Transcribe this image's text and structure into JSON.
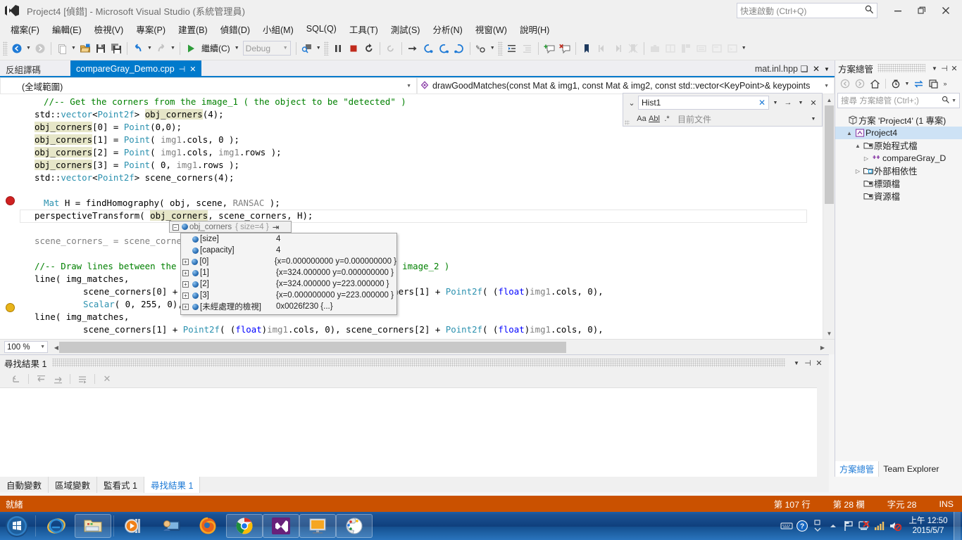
{
  "window": {
    "title": "Project4 [偵錯] - Microsoft Visual Studio (系統管理員)",
    "quick_launch_placeholder": "快速啟動 (Ctrl+Q)",
    "minimize": "—",
    "restore": "❐",
    "close": "✕"
  },
  "menu": {
    "items": [
      {
        "label": "檔案(F)"
      },
      {
        "label": "編輯(E)"
      },
      {
        "label": "檢視(V)"
      },
      {
        "label": "專案(P)"
      },
      {
        "label": "建置(B)"
      },
      {
        "label": "偵錯(D)"
      },
      {
        "label": "小組(M)"
      },
      {
        "label": "SQL(Q)"
      },
      {
        "label": "工具(T)"
      },
      {
        "label": "測試(S)"
      },
      {
        "label": "分析(N)"
      },
      {
        "label": "視窗(W)"
      },
      {
        "label": "說明(H)"
      }
    ]
  },
  "toolbar": {
    "continue_label": "繼續(C)",
    "config_value": "Debug"
  },
  "tabs": {
    "disasm_label": "反組譯碼",
    "active_label": "compareGray_Demo.cpp",
    "right_label": "mat.inl.hpp"
  },
  "navbar": {
    "scope": "(全域範圍)",
    "member": "drawGoodMatches(const Mat & img1, const Mat & img2, const std::vector<KeyPoint>& keypoints"
  },
  "editor": {
    "zoom": "100 %",
    "lines": [
      "//-- Get the corners from the image_1 ( the object to be \"detected\" )",
      "std::vector<Point2f> obj_corners(4);",
      "obj_corners[0] = Point(0,0);",
      "obj_corners[1] = Point( img1.cols, 0 );",
      "obj_corners[2] = Point( img1.cols, img1.rows );",
      "obj_corners[3] = Point( 0, img1.rows );",
      "std::vector<Point2f> scene_corners(4);",
      "",
      "Mat H = findHomography( obj, scene, RANSAC );",
      "perspectiveTransform( obj_corners, scene_corners, H);",
      "",
      "scene_corners_ = scene_corners;",
      "",
      "//-- Draw lines between the corners (the mapped object in the scene - image_2 )",
      "line( img_matches,",
      "      scene_corners[0] + Point2f( (float)img1.cols, 0), scene_corners[1] + Point2f( (float)img1.cols, 0),",
      "      Scalar( 0, 255, 0), 2, CV_AA );",
      "line( img_matches,",
      "      scene_corners[1] + Point2f( (float)img1.cols, 0), scene_corners[2] + Point2f( (float)img1.cols, 0),"
    ]
  },
  "find_popup": {
    "query": "Hist1",
    "scope": "目前文件",
    "match_case_icon": "Aa",
    "match_word_icon": "Abl",
    "regex_icon": ".*"
  },
  "datatip": {
    "header_name": "obj_corners",
    "header_meta": "{ size=4 }",
    "rows": [
      {
        "expander": "",
        "name": "[size]",
        "value": "4"
      },
      {
        "expander": "",
        "name": "[capacity]",
        "value": "4"
      },
      {
        "expander": "+",
        "name": "[0]",
        "value": "{x=0.000000000 y=0.000000000 }"
      },
      {
        "expander": "+",
        "name": "[1]",
        "value": "{x=324.000000 y=0.000000000 }"
      },
      {
        "expander": "+",
        "name": "[2]",
        "value": "{x=324.000000 y=223.000000 }"
      },
      {
        "expander": "+",
        "name": "[3]",
        "value": "{x=0.000000000 y=223.000000 }"
      },
      {
        "expander": "+",
        "name": "[未經處理的檢視]",
        "value": "0x0026f230 {...}"
      }
    ]
  },
  "find_results": {
    "title": "尋找結果 1"
  },
  "bottom_tabs": [
    {
      "label": "自動變數",
      "active": false
    },
    {
      "label": "區域變數",
      "active": false
    },
    {
      "label": "監看式 1",
      "active": false
    },
    {
      "label": "尋找結果 1",
      "active": true
    }
  ],
  "solution_explorer": {
    "title": "方案總管",
    "search_placeholder": "搜尋 方案總管 (Ctrl+;)",
    "tree": [
      {
        "label": "方案 'Project4' (1 專案)",
        "indent": 0,
        "twisty": "",
        "icon": "solution-icon",
        "selected": false
      },
      {
        "label": "Project4",
        "indent": 1,
        "twisty": "▲",
        "icon": "project-icon",
        "selected": true
      },
      {
        "label": "原始程式檔",
        "indent": 2,
        "twisty": "▲",
        "icon": "folder-icon",
        "selected": false
      },
      {
        "label": "compareGray_D",
        "indent": 3,
        "twisty": "▷",
        "icon": "cpp-file-icon",
        "selected": false
      },
      {
        "label": "外部相依性",
        "indent": 2,
        "twisty": "▷",
        "icon": "refs-icon",
        "selected": false
      },
      {
        "label": "標頭檔",
        "indent": 2,
        "twisty": "",
        "icon": "folder-icon",
        "selected": false
      },
      {
        "label": "資源檔",
        "indent": 2,
        "twisty": "",
        "icon": "folder-icon",
        "selected": false
      }
    ],
    "bottom_tabs": [
      {
        "label": "方案總管",
        "active": true
      },
      {
        "label": "Team Explorer",
        "active": false
      }
    ]
  },
  "status_bar": {
    "state": "就緒",
    "line": "第 107 行",
    "column": "第 28 欄",
    "character": "字元 28",
    "insert_mode": "INS"
  },
  "taskbar": {
    "clock_time": "上午 12:50",
    "clock_date": "2015/5/7"
  },
  "colors": {
    "accent": "#007acc",
    "status_bar": "#ca5100",
    "comment": "#008000",
    "keyword": "#0000ff",
    "type": "#2b91af"
  }
}
